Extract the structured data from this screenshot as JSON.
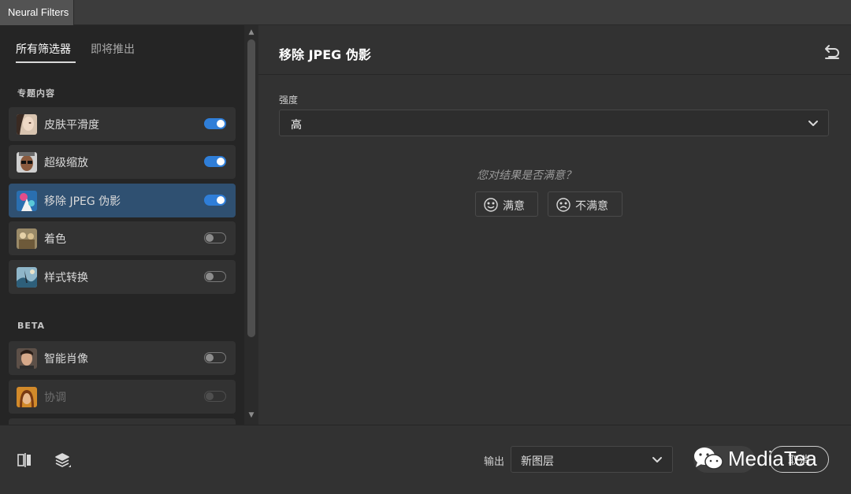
{
  "window": {
    "tab_title": "Neural Filters"
  },
  "sidebar": {
    "tabs": [
      {
        "label": "所有筛选器",
        "active": true
      },
      {
        "label": "即将推出",
        "active": false
      }
    ],
    "featured_title": "专题内容",
    "beta_title": "BETA",
    "featured_items": [
      {
        "label": "皮肤平滑度",
        "enabled": true,
        "selected": false,
        "icon": "portrait-thumbnail-icon"
      },
      {
        "label": "超级缩放",
        "enabled": true,
        "selected": false,
        "icon": "portrait-glasses-thumbnail-icon"
      },
      {
        "label": "移除 JPEG 伪影",
        "enabled": true,
        "selected": true,
        "icon": "artwork-thumbnail-icon"
      },
      {
        "label": "着色",
        "enabled": false,
        "selected": false,
        "icon": "vintage-photo-thumbnail-icon"
      },
      {
        "label": "样式转换",
        "enabled": false,
        "selected": false,
        "icon": "painting-thumbnail-icon"
      }
    ],
    "beta_items": [
      {
        "label": "智能肖像",
        "enabled": false,
        "selected": false,
        "disabled": false,
        "icon": "man-portrait-thumbnail-icon"
      },
      {
        "label": "协调",
        "enabled": false,
        "selected": false,
        "disabled": true,
        "icon": "woman-portrait-thumbnail-icon"
      }
    ]
  },
  "main": {
    "title": "移除 JPEG 伪影",
    "strength_label": "强度",
    "strength_value": "高",
    "feedback_question": "您对结果是否满意？",
    "satisfied_label": "满意",
    "unsatisfied_label": "不满意"
  },
  "bottom": {
    "output_label": "输出",
    "output_value": "新图层",
    "cancel_label": "取消"
  },
  "watermark": {
    "text": "MediaTea"
  },
  "colors": {
    "accent": "#2f7ed8",
    "selected_row": "#2f5071",
    "panel_bg": "#323232",
    "sidebar_bg": "#252525"
  }
}
